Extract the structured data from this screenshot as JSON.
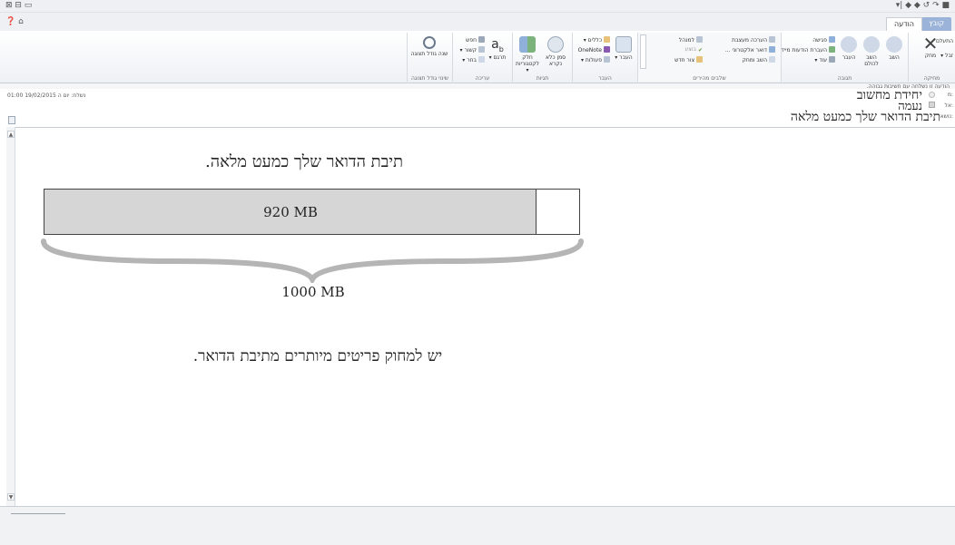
{
  "window": {
    "titlebar_right_glyphs": "▾| ◆ ◆ ↺ ↷ ■",
    "titlebar_left_glyphs": "⊠  ⊟  ▭",
    "help_glyphs": "❓ ⌂"
  },
  "tabs": [
    {
      "label": "קובץ"
    },
    {
      "label": "הודעה"
    }
  ],
  "ribbon": {
    "groups": [
      {
        "label": "מחיקה",
        "buttons": [
          {
            "label": "מחק",
            "icon": "delete-x-icon"
          },
          {
            "label": "התעלם"
          },
          {
            "label": "זבל ▾"
          }
        ]
      },
      {
        "label": "תגובה",
        "buttons": [
          {
            "label": "השב",
            "icon": "reply-icon"
          },
          {
            "label": "השב לכולם",
            "icon": "reply-all-icon"
          },
          {
            "label": "העבר",
            "icon": "forward-icon"
          },
          {
            "label": "פגישה",
            "icon": "meeting-icon"
          },
          {
            "label": "העברת הודעות מיידית ▾",
            "icon": "im-icon"
          },
          {
            "label": "עוד ▾",
            "icon": "more-icon"
          }
        ]
      },
      {
        "label": "שלבים מהירים",
        "buttons": [
          {
            "label": "הערכה מעצבת",
            "icon": "quickstep-icon"
          },
          {
            "label": "למנהל",
            "icon": "quickstep-icon"
          },
          {
            "label": "דואר אלקטרוני ...",
            "icon": "email-icon"
          },
          {
            "label": "בוצע",
            "icon": "done-icon"
          },
          {
            "label": "השב ומחק",
            "icon": "reply-delete-icon"
          },
          {
            "label": "צור חדש",
            "icon": "create-new-icon"
          }
        ]
      },
      {
        "label": "העבר",
        "buttons": [
          {
            "label": "העבר ▾",
            "icon": "move-icon"
          },
          {
            "label": "כללים ▾",
            "icon": "rules-icon"
          },
          {
            "label": "OneNote",
            "icon": "onenote-icon"
          },
          {
            "label": "פעולות ▾",
            "icon": "actions-icon"
          }
        ]
      },
      {
        "label": "תגיות",
        "buttons": [
          {
            "label": "סמן כלא נקרא",
            "icon": "unread-icon"
          },
          {
            "label": "חלק לקטגוריות ▾",
            "icon": "categorize-icon"
          }
        ]
      },
      {
        "label": "עריכה",
        "buttons": [
          {
            "label": "תרגם ▾",
            "icon": "translate-icon"
          },
          {
            "label": "חפש",
            "icon": "find-icon"
          },
          {
            "label": "קשור ▾",
            "icon": "related-icon"
          },
          {
            "label": "בחר ▾",
            "icon": "select-icon"
          }
        ]
      },
      {
        "label": "שינוי גודל תצוגה",
        "buttons": [
          {
            "label": "שנה גודל תצוגה",
            "icon": "zoom-icon"
          }
        ]
      }
    ]
  },
  "header": {
    "sent_label": "נשלח: יום ה 19/02/2015 01:00",
    "importance_note": "הודעה זו נשלחה עם חשיבות גבוהה.",
    "from": "יחידת מחשוב",
    "to": "נעמה",
    "subject": "תיבת הדואר שלך כמעט מלאה",
    "field_labels": [
      "מ:",
      "אל:",
      "נושא:"
    ]
  },
  "message": {
    "title": "תיבת הדואר שלך כמעט מלאה.",
    "used_label": "920 MB",
    "total_label": "1000 MB",
    "used_mb": 920,
    "total_mb": 1000,
    "instruction": "יש למחוק פריטים מיותרים מתיבת הדואר."
  },
  "colors": {
    "bar_fill": "#d6d6d6",
    "bar_border": "#444444",
    "brace": "#b5b5b5",
    "file_tab": "#9bb3d8"
  }
}
